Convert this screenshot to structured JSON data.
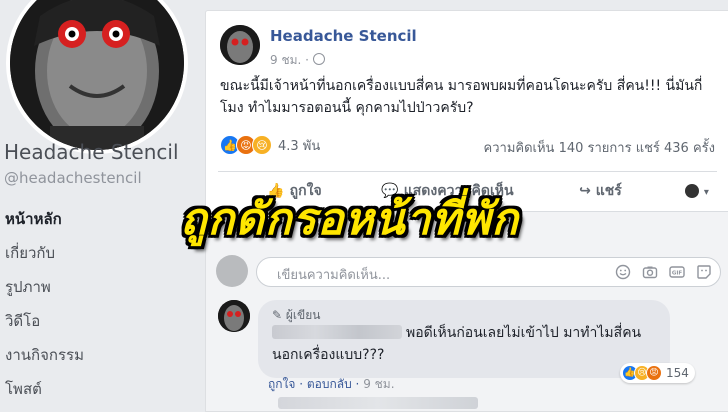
{
  "sidebar": {
    "page_name": "Headache Stencil",
    "handle": "@headachestencil",
    "items": [
      {
        "label": "หน้าหลัก",
        "active": true
      },
      {
        "label": "เกี่ยวกับ"
      },
      {
        "label": "รูปภาพ"
      },
      {
        "label": "วิดีโอ"
      },
      {
        "label": "งานกิจกรรม"
      },
      {
        "label": "โพสต์"
      }
    ]
  },
  "post": {
    "author": "Headache Stencil",
    "time": "9 ชม. ·",
    "text": "ขณะนี้มีเจ้าหน้าที่นอกเครื่องแบบสี่คน มารอพบผมที่คอนโดนะครับ สี่คน!!! นี่มันกี่โมง ทำไมมารอตอนนี้ คุกคามไปป่าวครับ?",
    "reaction_count": "4.3 พัน",
    "counts": "ความคิดเห็น 140 รายการ  แชร์ 436 ครั้ง",
    "actions": {
      "like": "ถูกใจ",
      "comment": "แสดงความคิดเห็น",
      "share": "แชร์"
    }
  },
  "comment_box": {
    "placeholder": "เขียนความคิดเห็น..."
  },
  "comment": {
    "tag": "ผู้เขียน",
    "text_line1": "พอดีเห็นก่อนเลยไม่เข้าไป มาทำไมสี่คน",
    "text_line2": "นอกเครื่องแบบ???",
    "reaction_count": "154",
    "like": "ถูกใจ",
    "reply": "ตอบกลับ",
    "time": "9 ชม."
  },
  "overlay": {
    "headline": "ถูกดักรอหน้าที่พัก"
  },
  "colors": {
    "link": "#385898",
    "overlay_text": "#ffe600",
    "angry": "#e9710f",
    "like": "#1877f2",
    "haha": "#f7b125"
  }
}
